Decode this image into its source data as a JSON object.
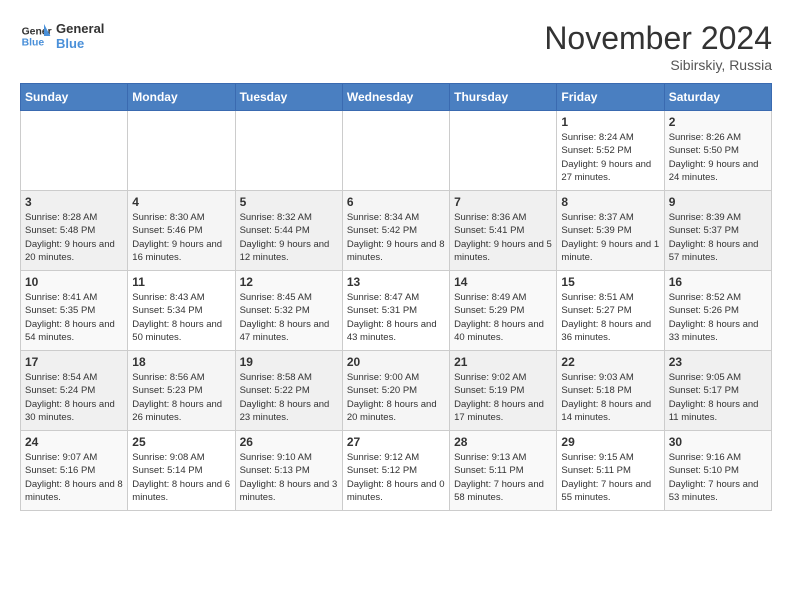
{
  "header": {
    "logo_line1": "General",
    "logo_line2": "Blue",
    "month": "November 2024",
    "location": "Sibirskiy, Russia"
  },
  "weekdays": [
    "Sunday",
    "Monday",
    "Tuesday",
    "Wednesday",
    "Thursday",
    "Friday",
    "Saturday"
  ],
  "weeks": [
    [
      {
        "day": "",
        "info": ""
      },
      {
        "day": "",
        "info": ""
      },
      {
        "day": "",
        "info": ""
      },
      {
        "day": "",
        "info": ""
      },
      {
        "day": "",
        "info": ""
      },
      {
        "day": "1",
        "info": "Sunrise: 8:24 AM\nSunset: 5:52 PM\nDaylight: 9 hours and 27 minutes."
      },
      {
        "day": "2",
        "info": "Sunrise: 8:26 AM\nSunset: 5:50 PM\nDaylight: 9 hours and 24 minutes."
      }
    ],
    [
      {
        "day": "3",
        "info": "Sunrise: 8:28 AM\nSunset: 5:48 PM\nDaylight: 9 hours and 20 minutes."
      },
      {
        "day": "4",
        "info": "Sunrise: 8:30 AM\nSunset: 5:46 PM\nDaylight: 9 hours and 16 minutes."
      },
      {
        "day": "5",
        "info": "Sunrise: 8:32 AM\nSunset: 5:44 PM\nDaylight: 9 hours and 12 minutes."
      },
      {
        "day": "6",
        "info": "Sunrise: 8:34 AM\nSunset: 5:42 PM\nDaylight: 9 hours and 8 minutes."
      },
      {
        "day": "7",
        "info": "Sunrise: 8:36 AM\nSunset: 5:41 PM\nDaylight: 9 hours and 5 minutes."
      },
      {
        "day": "8",
        "info": "Sunrise: 8:37 AM\nSunset: 5:39 PM\nDaylight: 9 hours and 1 minute."
      },
      {
        "day": "9",
        "info": "Sunrise: 8:39 AM\nSunset: 5:37 PM\nDaylight: 8 hours and 57 minutes."
      }
    ],
    [
      {
        "day": "10",
        "info": "Sunrise: 8:41 AM\nSunset: 5:35 PM\nDaylight: 8 hours and 54 minutes."
      },
      {
        "day": "11",
        "info": "Sunrise: 8:43 AM\nSunset: 5:34 PM\nDaylight: 8 hours and 50 minutes."
      },
      {
        "day": "12",
        "info": "Sunrise: 8:45 AM\nSunset: 5:32 PM\nDaylight: 8 hours and 47 minutes."
      },
      {
        "day": "13",
        "info": "Sunrise: 8:47 AM\nSunset: 5:31 PM\nDaylight: 8 hours and 43 minutes."
      },
      {
        "day": "14",
        "info": "Sunrise: 8:49 AM\nSunset: 5:29 PM\nDaylight: 8 hours and 40 minutes."
      },
      {
        "day": "15",
        "info": "Sunrise: 8:51 AM\nSunset: 5:27 PM\nDaylight: 8 hours and 36 minutes."
      },
      {
        "day": "16",
        "info": "Sunrise: 8:52 AM\nSunset: 5:26 PM\nDaylight: 8 hours and 33 minutes."
      }
    ],
    [
      {
        "day": "17",
        "info": "Sunrise: 8:54 AM\nSunset: 5:24 PM\nDaylight: 8 hours and 30 minutes."
      },
      {
        "day": "18",
        "info": "Sunrise: 8:56 AM\nSunset: 5:23 PM\nDaylight: 8 hours and 26 minutes."
      },
      {
        "day": "19",
        "info": "Sunrise: 8:58 AM\nSunset: 5:22 PM\nDaylight: 8 hours and 23 minutes."
      },
      {
        "day": "20",
        "info": "Sunrise: 9:00 AM\nSunset: 5:20 PM\nDaylight: 8 hours and 20 minutes."
      },
      {
        "day": "21",
        "info": "Sunrise: 9:02 AM\nSunset: 5:19 PM\nDaylight: 8 hours and 17 minutes."
      },
      {
        "day": "22",
        "info": "Sunrise: 9:03 AM\nSunset: 5:18 PM\nDaylight: 8 hours and 14 minutes."
      },
      {
        "day": "23",
        "info": "Sunrise: 9:05 AM\nSunset: 5:17 PM\nDaylight: 8 hours and 11 minutes."
      }
    ],
    [
      {
        "day": "24",
        "info": "Sunrise: 9:07 AM\nSunset: 5:16 PM\nDaylight: 8 hours and 8 minutes."
      },
      {
        "day": "25",
        "info": "Sunrise: 9:08 AM\nSunset: 5:14 PM\nDaylight: 8 hours and 6 minutes."
      },
      {
        "day": "26",
        "info": "Sunrise: 9:10 AM\nSunset: 5:13 PM\nDaylight: 8 hours and 3 minutes."
      },
      {
        "day": "27",
        "info": "Sunrise: 9:12 AM\nSunset: 5:12 PM\nDaylight: 8 hours and 0 minutes."
      },
      {
        "day": "28",
        "info": "Sunrise: 9:13 AM\nSunset: 5:11 PM\nDaylight: 7 hours and 58 minutes."
      },
      {
        "day": "29",
        "info": "Sunrise: 9:15 AM\nSunset: 5:11 PM\nDaylight: 7 hours and 55 minutes."
      },
      {
        "day": "30",
        "info": "Sunrise: 9:16 AM\nSunset: 5:10 PM\nDaylight: 7 hours and 53 minutes."
      }
    ]
  ]
}
